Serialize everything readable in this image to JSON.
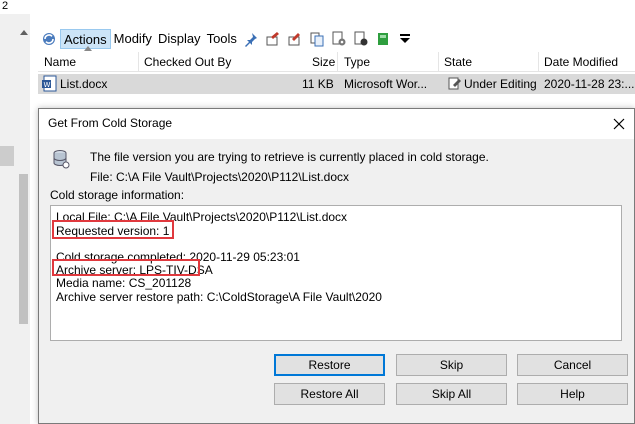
{
  "window": {
    "corner_label": "2"
  },
  "toolbar": {
    "menus": [
      "Actions",
      "Modify",
      "Display",
      "Tools"
    ],
    "active_menu_index": 0,
    "icons": [
      "refresh-icon",
      "pin-icon",
      "check-out-icon",
      "undo-check-out-icon",
      "copy-icon",
      "settings-icon",
      "preview-icon",
      "archive-icon",
      "dropdown-icon"
    ]
  },
  "list": {
    "columns": [
      "Name",
      "Checked Out By",
      "Size",
      "Type",
      "State",
      "Date Modified"
    ],
    "rows": [
      {
        "name": "List.docx",
        "checked_out_by": "",
        "size": "11 KB",
        "type": "Microsoft Wor...",
        "state": "Under Editing",
        "date_modified": "2020-11-28 23:..."
      }
    ]
  },
  "dialog": {
    "title": "Get From Cold Storage",
    "message": "The file version you are trying to retrieve is currently placed in cold storage.",
    "file_path": "File: C:\\A File Vault\\Projects\\2020\\P112\\List.docx",
    "info_label": "Cold storage information:",
    "info_lines": [
      "Local File: C:\\A File Vault\\Projects\\2020\\P112\\List.docx",
      "Requested version: 1",
      "",
      "Cold storage completed: 2020-11-29 05:23:01",
      "Archive server: LPS-TIV-DSA",
      "Media name: CS_201128",
      "Archive server restore path: C:\\ColdStorage\\A File Vault\\2020"
    ],
    "buttons": {
      "restore": "Restore",
      "skip": "Skip",
      "cancel": "Cancel",
      "restore_all": "Restore All",
      "skip_all": "Skip All",
      "help": "Help"
    }
  },
  "colors": {
    "highlight_box": "#e0393e",
    "selection": "#d9d9d9",
    "default_button_border": "#0078d7"
  }
}
